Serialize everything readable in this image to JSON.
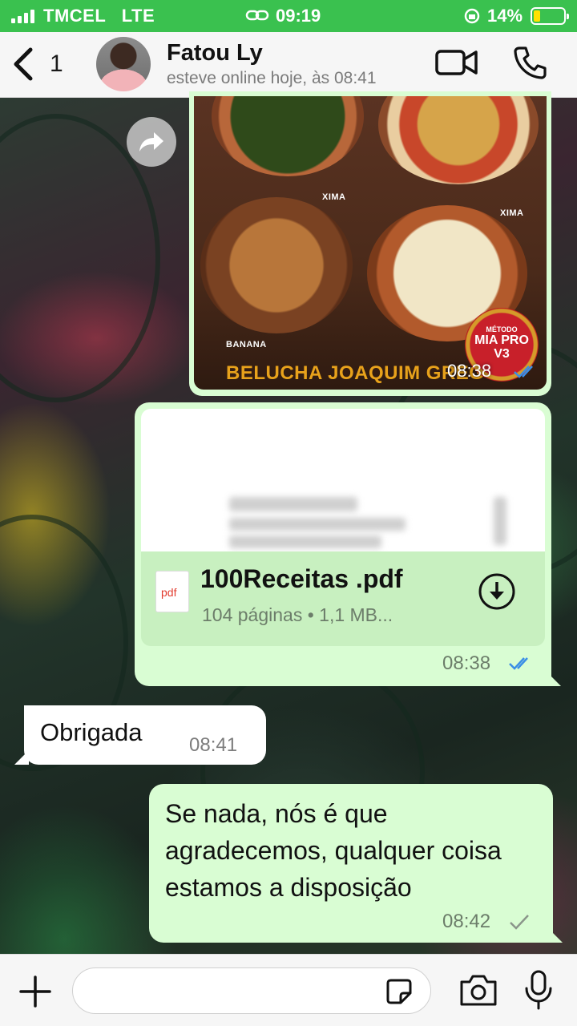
{
  "status_bar": {
    "carrier": "TMCEL   LTE",
    "time": "09:19",
    "battery_percent": "14%",
    "battery_level": 0.14,
    "accent_color": "#3ac14f"
  },
  "header": {
    "back_count": "1",
    "contact_name": "Fatou Ly",
    "contact_status": "esteve online hoje, às 08:41"
  },
  "messages": {
    "image": {
      "label_top_left": "XIMA",
      "label_right": "XIMA",
      "label_bottom_left": "BANANA",
      "caption": "BELUCHA JOAQUIM GREG",
      "badge_line1": "MÉTODO",
      "badge_line2": "MIA PRO",
      "badge_line3": "V3",
      "time": "08:38"
    },
    "document": {
      "file_icon_label": "pdf",
      "file_name": "100Receitas .pdf",
      "file_meta": "104 páginas • 1,1 MB...",
      "time": "08:38"
    },
    "incoming": {
      "text": "Obrigada",
      "time": "08:41"
    },
    "outgoing": {
      "text": "Se nada, nós é que agradecemos, qualquer coisa estamos a disposição",
      "time": "08:42"
    }
  },
  "input_bar": {
    "placeholder": ""
  },
  "colors": {
    "bubble_out": "#d9fdd3",
    "bubble_in": "#ffffff",
    "read_ticks": "#3a8ee6"
  }
}
